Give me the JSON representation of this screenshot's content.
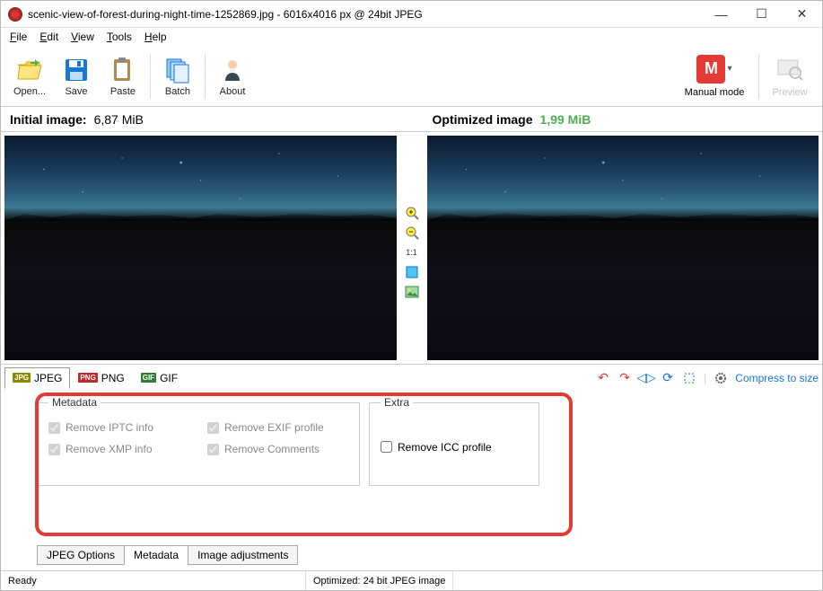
{
  "title": "scenic-view-of-forest-during-night-time-1252869.jpg - 6016x4016 px @ 24bit JPEG",
  "menu": {
    "file": "File",
    "edit": "Edit",
    "view": "View",
    "tools": "Tools",
    "help": "Help"
  },
  "toolbar": {
    "open": "Open...",
    "save": "Save",
    "paste": "Paste",
    "batch": "Batch",
    "about": "About",
    "manual_mode": "Manual mode",
    "manual_badge": "M",
    "preview": "Preview"
  },
  "info": {
    "initial_label": "Initial image:",
    "initial_value": "6,87 MiB",
    "optimized_label": "Optimized image",
    "optimized_value": "1,99 MiB"
  },
  "mid_tools": {
    "zoom_in": "zoom-in",
    "zoom_out": "zoom-out",
    "one_to_one": "1:1",
    "fit": "fit",
    "pic": "picture"
  },
  "formats": {
    "jpeg": "JPEG",
    "png": "PNG",
    "gif": "GIF"
  },
  "format_right": {
    "compress": "Compress to size"
  },
  "panel": {
    "metadata_legend": "Metadata",
    "extra_legend": "Extra",
    "remove_iptc": "Remove IPTC info",
    "remove_exif": "Remove EXIF profile",
    "remove_xmp": "Remove XMP info",
    "remove_comments": "Remove Comments",
    "remove_icc": "Remove ICC profile"
  },
  "bottom_tabs": {
    "jpeg_options": "JPEG Options",
    "metadata": "Metadata",
    "image_adj": "Image adjustments"
  },
  "status": {
    "ready": "Ready",
    "optimized": "Optimized: 24 bit JPEG image"
  }
}
